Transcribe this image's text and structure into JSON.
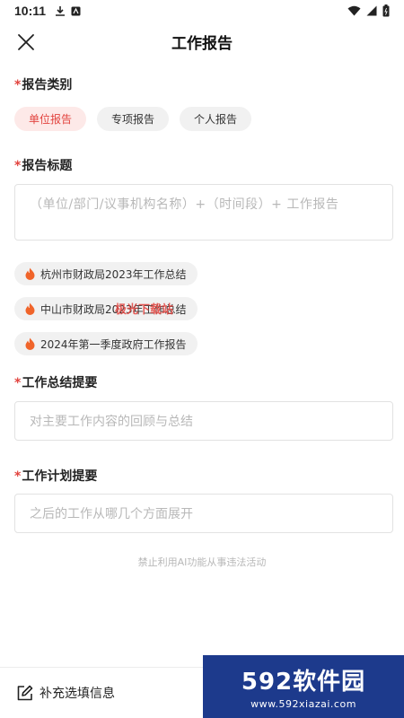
{
  "status_bar": {
    "time": "10:11"
  },
  "header": {
    "title": "工作报告"
  },
  "report_category": {
    "label": "报告类别",
    "options": [
      "单位报告",
      "专项报告",
      "个人报告"
    ],
    "selected": "单位报告"
  },
  "report_title": {
    "label": "报告标题",
    "placeholder": "（单位/部门/议事机构名称）+（时间段）+ 工作报告",
    "suggestions": [
      "杭州市财政局2023年工作总结",
      "中山市财政局2023年工作总结",
      "2024年第一季度政府工作报告"
    ]
  },
  "summary": {
    "label": "工作总结提要",
    "placeholder": "对主要工作内容的回顾与总结"
  },
  "plan": {
    "label": "工作计划提要",
    "placeholder": "之后的工作从哪几个方面展开"
  },
  "notice": "禁止利用AI功能从事违法活动",
  "bottom": {
    "supplement_label": "补充选填信息"
  },
  "watermark": {
    "center_text": "极光下载站",
    "brand": "592软件园",
    "url": "www.592xiazai.com"
  },
  "colors": {
    "accent": "#e2433e",
    "chip_active_bg": "#fde9e8",
    "chip_bg": "#f1f1f1"
  }
}
